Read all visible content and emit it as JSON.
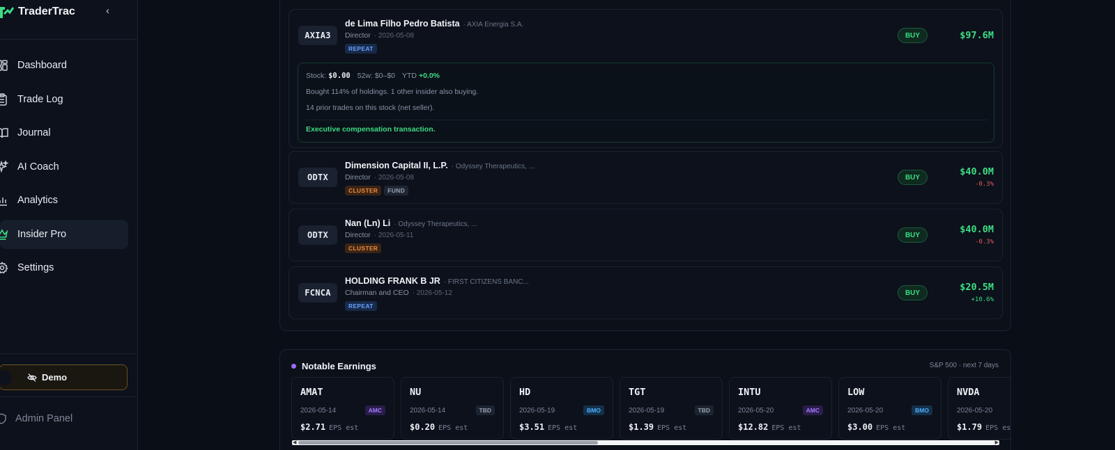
{
  "sidebar": {
    "brand": "TraderTrac",
    "collapse_icon": "chevron-left-icon",
    "items": [
      {
        "label": "Dashboard",
        "icon": "grid-icon"
      },
      {
        "label": "Trade Log",
        "icon": "clipboard-icon"
      },
      {
        "label": "Journal",
        "icon": "book-icon"
      },
      {
        "label": "AI Coach",
        "icon": "sparkle-icon"
      },
      {
        "label": "Analytics",
        "icon": "bar-chart-icon"
      },
      {
        "label": "Insider Pro",
        "icon": "crown-icon",
        "active": true
      },
      {
        "label": "Settings",
        "icon": "gear-icon"
      }
    ],
    "demo_label": "Demo",
    "admin_label": "Admin Panel"
  },
  "trades": [
    {
      "ticker": "AXIA3",
      "name": "de Lima Filho Pedro Batista",
      "company": "· AXIA Energia S.A.",
      "role": "Director",
      "date": "· 2026-05-08",
      "tags": [
        "REPEAT"
      ],
      "action": "BUY",
      "amount": "$97.6M",
      "change": "",
      "expanded": {
        "stock_label": "Stock:",
        "stock_value": "$0.00",
        "week52": "52w: $0–$0",
        "ytd_label": "YTD",
        "ytd_value": "+0.0%",
        "line1": "Bought 114% of holdings. 1 other insider also buying.",
        "line2": "14 prior trades on this stock (net seller).",
        "note": "Executive compensation transaction."
      }
    },
    {
      "ticker": "ODTX",
      "name": "Dimension Capital II, L.P.",
      "company": "· Odyssey Therapeutics, ...",
      "role": "Director",
      "date": "· 2026-05-08",
      "tags": [
        "CLUSTER",
        "FUND"
      ],
      "action": "BUY",
      "amount": "$40.0M",
      "change": "-0.3%"
    },
    {
      "ticker": "ODTX",
      "name": "Nan (Ln) Li",
      "company": "· Odyssey Therapeutics, ...",
      "role": "Director",
      "date": "· 2026-05-11",
      "tags": [
        "CLUSTER"
      ],
      "action": "BUY",
      "amount": "$40.0M",
      "change": "-0.3%"
    },
    {
      "ticker": "FCNCA",
      "name": "HOLDING FRANK B JR",
      "company": "· FIRST CITIZENS BANC...",
      "role": "Chairman and CEO",
      "date": "· 2026-05-12",
      "tags": [
        "REPEAT"
      ],
      "action": "BUY",
      "amount": "$20.5M",
      "change": "+10.6%"
    }
  ],
  "earnings": {
    "title": "Notable Earnings",
    "meta": "S&P 500 · next 7 days",
    "eps_label": "EPS est",
    "cards": [
      {
        "ticker": "AMAT",
        "date": "2026-05-14",
        "timing": "AMC",
        "eps": "$2.71"
      },
      {
        "ticker": "NU",
        "date": "2026-05-14",
        "timing": "TBD",
        "eps": "$0.20"
      },
      {
        "ticker": "HD",
        "date": "2026-05-19",
        "timing": "BMO",
        "eps": "$3.51"
      },
      {
        "ticker": "TGT",
        "date": "2026-05-19",
        "timing": "TBD",
        "eps": "$1.39"
      },
      {
        "ticker": "INTU",
        "date": "2026-05-20",
        "timing": "AMC",
        "eps": "$12.82"
      },
      {
        "ticker": "LOW",
        "date": "2026-05-20",
        "timing": "BMO",
        "eps": "$3.00"
      },
      {
        "ticker": "NVDA",
        "date": "2026-05-20",
        "timing": "",
        "eps": "$1.79"
      }
    ]
  },
  "colors": {
    "accent_green": "#3ddc84",
    "repeat_blue": "#6aa1ff",
    "cluster_orange": "#f28a3c",
    "negative_red": "#e35d5d",
    "amc_purple": "#a67cff"
  }
}
